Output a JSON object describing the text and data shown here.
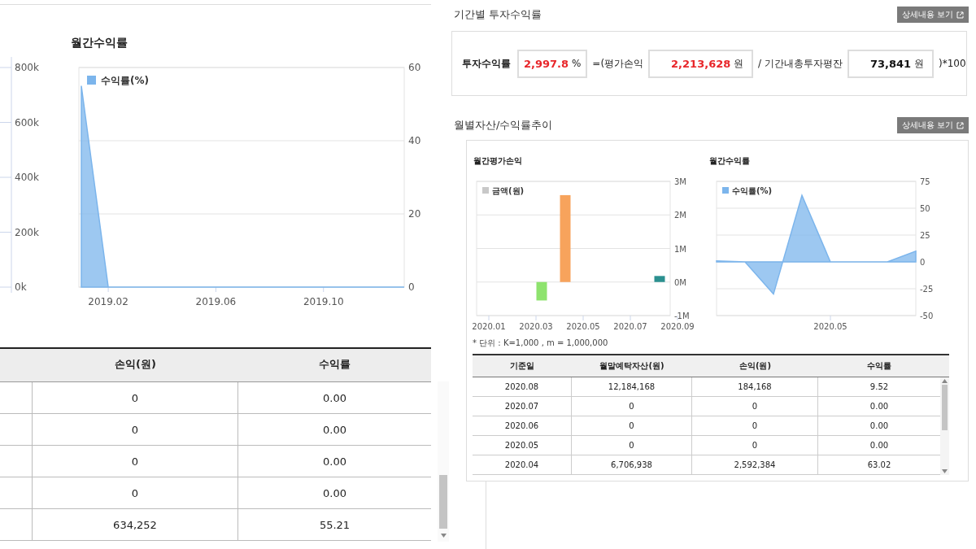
{
  "left_panel": {
    "cut_axis_ticks": [
      "800k",
      "600k",
      "400k",
      "200k",
      "0k"
    ],
    "chart": {
      "title": "월간수익률",
      "chart_data": {
        "type": "area",
        "categories": [
          null,
          "2019.02",
          null,
          null,
          null,
          "2019.06",
          null,
          null,
          null,
          "2019.10",
          null,
          null,
          null
        ],
        "series": [
          {
            "name": "수익률(%)",
            "color": "#7cb5ec",
            "values": [
              55,
              0,
              0,
              0,
              0,
              0,
              0,
              0,
              0,
              0,
              0,
              0,
              0
            ]
          }
        ],
        "ylim": [
          0,
          60
        ],
        "yticks": [
          0,
          20,
          40,
          60
        ],
        "grid": true
      }
    },
    "table": {
      "columns": [
        "손익(원)",
        "수익률"
      ],
      "rows": [
        [
          "0",
          "0.00"
        ],
        [
          "0",
          "0.00"
        ],
        [
          "0",
          "0.00"
        ],
        [
          "0",
          "0.00"
        ],
        [
          "634,252",
          "55.21"
        ]
      ]
    }
  },
  "right_panel": {
    "returns_section": {
      "title": "기간별 투자수익률",
      "detail_button": "상세내용 보기",
      "formula": [
        {
          "kind": "label",
          "text": "투자수익률"
        },
        {
          "kind": "value",
          "value": "2,997.8",
          "unit": "%",
          "color": "#e8262a"
        },
        {
          "kind": "operator",
          "text": "=(평가손익"
        },
        {
          "kind": "value",
          "value": "2,213,628",
          "unit": "원",
          "color": "#e8262a"
        },
        {
          "kind": "operator",
          "text": "/ 기간내총투자평잔"
        },
        {
          "kind": "value",
          "value": "73,841",
          "unit": "원",
          "color": "#111111"
        },
        {
          "kind": "operator",
          "text": ")*100"
        }
      ]
    },
    "trend_section": {
      "title": "월별자산/수익률추이",
      "detail_button": "상세내용 보기",
      "charts": [
        {
          "title": "월간평가손익",
          "legend": {
            "label": "금액(원)",
            "color": "#c8c8c8"
          },
          "chart_data": {
            "type": "bar",
            "categories": [
              "2020.01",
              null,
              "2020.03",
              null,
              "2020.05",
              null,
              "2020.07",
              null,
              "2020.09"
            ],
            "series": [
              {
                "color": "#8ee36e",
                "values": [
                  null,
                  null,
                  -0.55,
                  null,
                  null,
                  null,
                  null,
                  null,
                  null
                ]
              },
              {
                "color": "#f7a35c",
                "values": [
                  null,
                  null,
                  null,
                  2.59,
                  null,
                  null,
                  null,
                  null,
                  null
                ]
              },
              {
                "color": "#2b908f",
                "values": [
                  null,
                  null,
                  null,
                  null,
                  null,
                  null,
                  null,
                  0.18,
                  null
                ]
              }
            ],
            "ylim": [
              -1,
              3
            ],
            "grid": true,
            "yticks": [
              {
                "value": 3,
                "label": "3M"
              },
              {
                "value": 2,
                "label": "2M"
              },
              {
                "value": 1,
                "label": "1M"
              },
              {
                "value": 0,
                "label": "0M"
              },
              {
                "value": -1,
                "label": "-1M"
              }
            ]
          }
        },
        {
          "title": "월간수익률",
          "chart_data": {
            "type": "area",
            "categories": [
              null,
              null,
              null,
              null,
              "2020.05",
              null,
              null,
              null
            ],
            "series": [
              {
                "name": "수익률(%)",
                "color": "#7cb5ec",
                "values": [
                  1,
                  0,
                  -30,
                  62,
                  0,
                  0,
                  0,
                  10
                ]
              }
            ],
            "ylim": [
              -50,
              75
            ],
            "yticks": [
              75,
              50,
              25,
              0,
              -25,
              -50
            ],
            "grid": true
          }
        }
      ],
      "unit_note": "* 단위 : K=1,000 , m = 1,000,000",
      "table": {
        "columns": [
          "기준일",
          "월말예탁자산(원)",
          "손익(원)",
          "수익률"
        ],
        "rows": [
          [
            "2020.08",
            "12,184,168",
            "184,168",
            "9.52"
          ],
          [
            "2020.07",
            "0",
            "0",
            "0.00"
          ],
          [
            "2020.06",
            "0",
            "0",
            "0.00"
          ],
          [
            "2020.05",
            "0",
            "0",
            "0.00"
          ],
          [
            "2020.04",
            "6,706,938",
            "2,592,384",
            "63.02"
          ]
        ]
      }
    }
  }
}
